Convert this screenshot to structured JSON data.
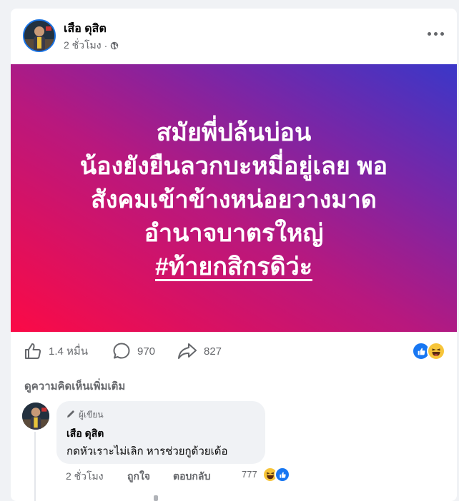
{
  "post": {
    "author": "เสือ ดุสิต",
    "time": "2 ชั่วโมง",
    "separator": "·",
    "banner_lines": [
      "สมัยพี่ปล้นบ่อน",
      "น้องยังยืนลวกบะหมี่อยู่เลย พอ",
      "สังคมเข้าข้างหน่อยวางมาด",
      "อำนาจบาตรใหญ่"
    ],
    "hashtag": "#ท้ายกสิกรดิว่ะ",
    "gradient_colors": [
      "#fb0a46",
      "#b8187e",
      "#7a26a6",
      "#3a37c8"
    ]
  },
  "stats": {
    "likes": "1.4 หมื่น",
    "comments": "970",
    "shares": "827"
  },
  "comments_section": {
    "view_more": "ดูความคิดเห็นเพิ่มเติม",
    "comment": {
      "badge": "ผู้เขียน",
      "author": "เสือ ดุสิต",
      "text": "กดหัวเราะไม่เลิก หารช่วยกูด้วยเด้อ",
      "time": "2 ชั่วโมง",
      "like_label": "ถูกใจ",
      "reply_label": "ตอบกลับ",
      "reaction_count": "777"
    }
  },
  "colors": {
    "accent": "#1b74e4",
    "secondary_text": "#65676b",
    "bubble": "#f0f2f5",
    "like_blue": "#1877f2",
    "haha_yellow": "#f7c53a"
  },
  "icons": {
    "globe": "globe-icon",
    "more": "more-options-icon",
    "like": "thumbs-up-icon",
    "comment": "comment-icon",
    "share": "share-icon",
    "pencil": "pencil-icon"
  }
}
